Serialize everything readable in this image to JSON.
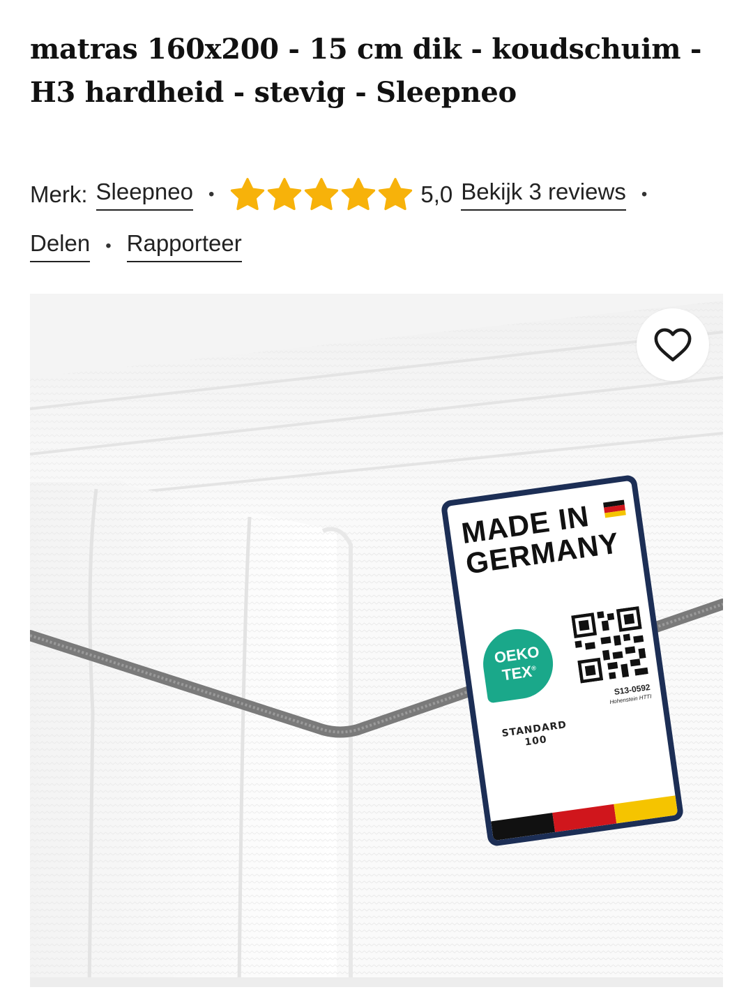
{
  "product": {
    "title": "matras 160x200 - 15 cm dik - koudschuim - H3 hardheid - stevig - Sleepneo",
    "brand_label": "Merk:",
    "brand_name": "Sleepneo",
    "rating_value": "5,0",
    "rating_stars": 5,
    "rating_max": 5,
    "reviews_link": "Bekijk 3 reviews",
    "share_link": "Delen",
    "report_link": "Rapporteer",
    "separator": "•"
  },
  "image": {
    "label_made_in": "MADE IN",
    "label_country": "GERMANY",
    "label_oeko": "OEKO TEX",
    "label_reg_mark": "®",
    "label_code": "S13-0592",
    "label_institute": "Hohenstein HTTI",
    "label_standard": "STANDARD",
    "label_standard_num": "100"
  },
  "colors": {
    "star": "#f7b20a",
    "label_border": "#1c2e55",
    "oeko_green": "#1aa88a",
    "flag_black": "#111111",
    "flag_red": "#d0161c",
    "flag_gold": "#f5c400"
  },
  "icons": {
    "favorite": "heart-outline-icon",
    "rating": "star-icon"
  }
}
